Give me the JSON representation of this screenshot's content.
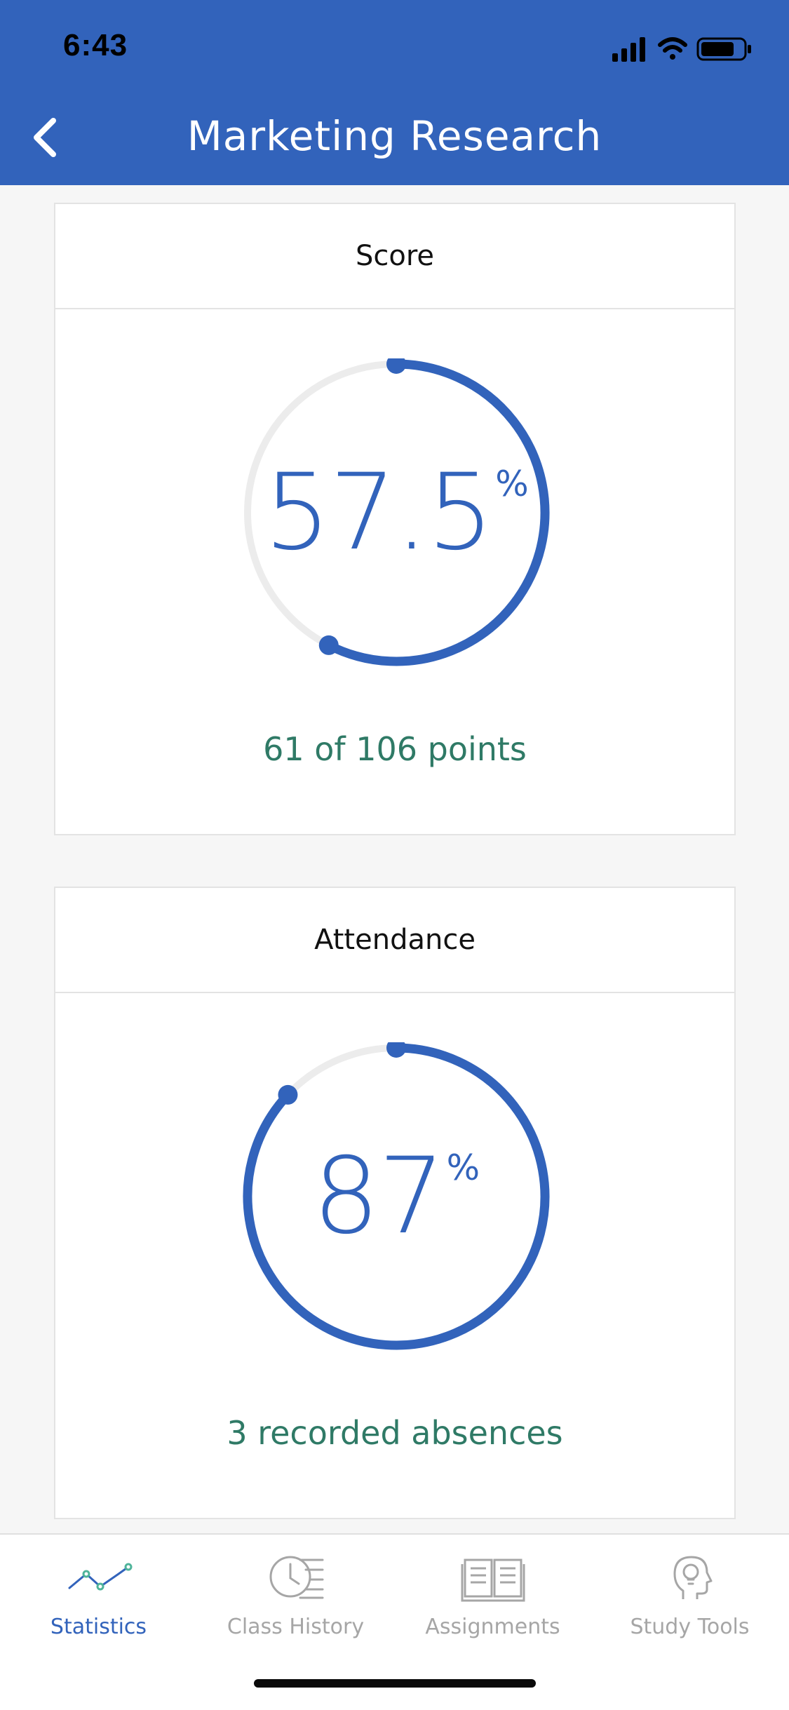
{
  "status_bar": {
    "time": "6:43"
  },
  "header": {
    "title": "Marketing Research",
    "back_icon": "chevron-left-icon"
  },
  "score_card": {
    "title": "Score",
    "value": "57.5",
    "unit": "%",
    "progress_fraction": 0.575,
    "caption": "61 of 106 points"
  },
  "attendance_card": {
    "title": "Attendance",
    "value": "87",
    "unit": "%",
    "progress_fraction": 0.87,
    "caption": "3 recorded absences"
  },
  "tabs": [
    {
      "label": "Statistics",
      "icon": "line-chart-icon",
      "active": true
    },
    {
      "label": "Class History",
      "icon": "clock-list-icon",
      "active": false
    },
    {
      "label": "Assignments",
      "icon": "open-book-icon",
      "active": false
    },
    {
      "label": "Study Tools",
      "icon": "head-lightbulb-icon",
      "active": false
    }
  ],
  "colors": {
    "brand_blue": "#3263bb",
    "caption_green": "#2f7a66",
    "ring_track": "#ececec",
    "tab_inactive": "#a6a6a6",
    "tab_active_icon": "#4fb49a"
  }
}
